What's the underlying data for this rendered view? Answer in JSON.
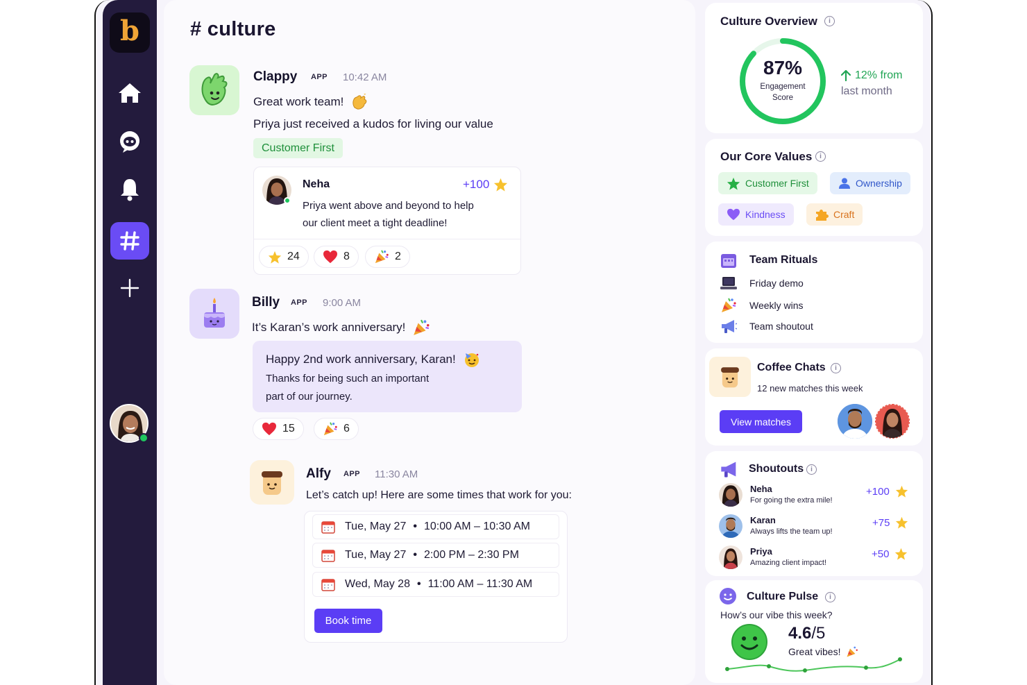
{
  "sidebar": {
    "logo": "b",
    "items": [
      {
        "name": "home"
      },
      {
        "name": "bot"
      },
      {
        "name": "notifications"
      },
      {
        "name": "channels"
      },
      {
        "name": "add"
      }
    ]
  },
  "channel": {
    "hash": "#",
    "name": "culture"
  },
  "messages": [
    {
      "author": "Clappy",
      "tag": "APP",
      "time": "10:42 AM",
      "text1": "Great work team!",
      "text2": "Priya just received a kudos for living our value",
      "value": "Customer First",
      "kudos": {
        "name": "Neha",
        "points": "+100",
        "line1": "Priya went above and beyond to help",
        "line2": "our client meet a tight deadline!"
      },
      "reactions": [
        {
          "icon": "star",
          "count": "24"
        },
        {
          "icon": "heart",
          "count": "8"
        },
        {
          "icon": "party",
          "count": "2"
        }
      ]
    },
    {
      "author": "Billy",
      "tag": "APP",
      "time": "9:00 AM",
      "text1": "It’s Karan’s work anniversary!",
      "card": {
        "line1": "Happy 2nd work anniversary, Karan!",
        "line2": "Thanks for being such an important",
        "line3": "part of our journey."
      },
      "reactions": [
        {
          "icon": "heart",
          "count": "15"
        },
        {
          "icon": "party",
          "count": "6"
        }
      ]
    },
    {
      "author": "Alfy",
      "tag": "APP",
      "time": "11:30 AM",
      "text1": "Let’s catch up! Here are some times that work for you:",
      "slots": [
        {
          "day": "Tue, May 27",
          "time": "10:00 AM – 10:30 AM"
        },
        {
          "day": "Tue, May 27",
          "time": "2:00 PM – 2:30 PM"
        },
        {
          "day": "Wed, May 28",
          "time": "11:00 AM – 11:30 AM"
        }
      ],
      "button": "Book time"
    }
  ],
  "overview": {
    "title": "Culture Overview",
    "score": "87%",
    "score_value": 87,
    "score_label1": "Engagement",
    "score_label2": "Score",
    "trend1": "12% from",
    "trend2": "last month"
  },
  "core_values": {
    "title": "Our Core Values",
    "items": [
      {
        "label": "Customer First",
        "icon": "star-icon"
      },
      {
        "label": "Ownership",
        "icon": "person-icon"
      },
      {
        "label": "Kindness",
        "icon": "heart-icon"
      },
      {
        "label": "Craft",
        "icon": "puzzle-icon"
      }
    ]
  },
  "rituals": {
    "title": "Team Rituals",
    "items": [
      {
        "label": "Friday demo",
        "icon": "laptop-icon"
      },
      {
        "label": "Weekly wins",
        "icon": "party-icon"
      },
      {
        "label": "Team shoutout",
        "icon": "megaphone-icon"
      }
    ]
  },
  "coffee": {
    "title": "Coffee Chats",
    "subtitle": "12 new matches this week",
    "button": "View matches"
  },
  "shoutouts": {
    "title": "Shoutouts",
    "items": [
      {
        "name": "Neha",
        "desc": "For going the extra mile!",
        "points": "+100"
      },
      {
        "name": "Karan",
        "desc": "Always lifts the team up!",
        "points": "+75"
      },
      {
        "name": "Priya",
        "desc": "Amazing client impact!",
        "points": "+50"
      }
    ]
  },
  "pulse": {
    "title": "Culture Pulse",
    "question": "How’s our vibe this week?",
    "score": "4.6",
    "out_of": "/5",
    "caption": "Great vibes!"
  },
  "colors": {
    "accent": "#5b3df5",
    "sidebar": "#231b3d",
    "green": "#22c55e",
    "logo": "#f0a436"
  }
}
